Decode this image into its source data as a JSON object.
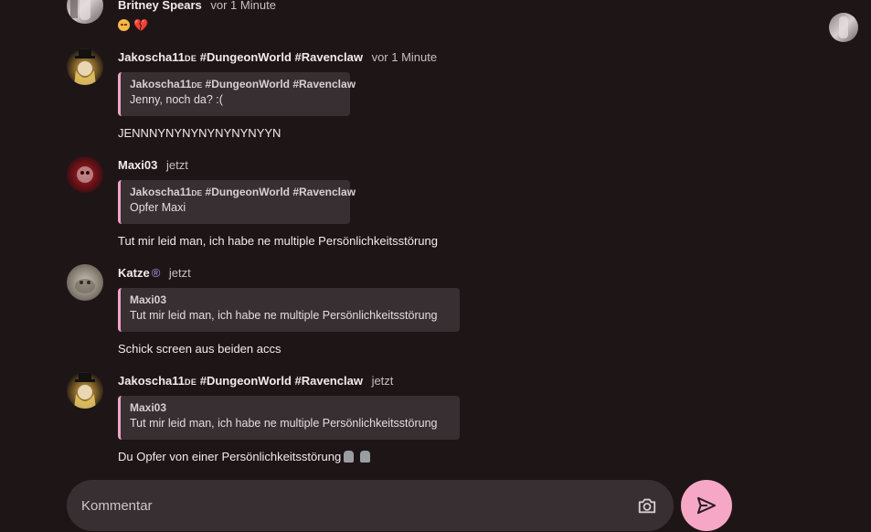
{
  "messages": [
    {
      "author": "Britney Spears",
      "author_suffix": "",
      "tags": "",
      "time": "vor 1 Minute",
      "quote": null,
      "body": ""
    },
    {
      "author": "Jakoscha11",
      "author_suffix": "DE",
      "tags": "#DungeonWorld #Ravenclaw",
      "time": "vor 1 Minute",
      "quote": {
        "author": "Jakoscha11",
        "author_suffix": "DE",
        "tags": "#DungeonWorld #Ravenclaw",
        "text": "Jenny, noch da? :("
      },
      "body": "JENNNYNYNYNYNYNYNYYN"
    },
    {
      "author": "Maxi03",
      "author_suffix": "",
      "tags": "",
      "time": "jetzt",
      "quote": {
        "author": "Jakoscha11",
        "author_suffix": "DE",
        "tags": "#DungeonWorld #Ravenclaw",
        "text": "Opfer Maxi"
      },
      "body": "Tut mir leid man, ich habe ne multiple Persönlichkeitsstörung"
    },
    {
      "author": "Katze",
      "author_suffix": "",
      "tags": "",
      "verified": "®",
      "time": "jetzt",
      "quote": {
        "author": "Maxi03",
        "author_suffix": "",
        "tags": "",
        "text": "Tut mir leid man, ich habe ne multiple Persönlichkeitsstörung"
      },
      "body": "Schick screen aus beiden accs"
    },
    {
      "author": "Jakoscha11",
      "author_suffix": "DE",
      "tags": "#DungeonWorld #Ravenclaw",
      "time": "jetzt",
      "quote": {
        "author": "Maxi03",
        "author_suffix": "",
        "tags": "",
        "text": "Tut mir leid man, ich habe ne multiple Persönlichkeitsstörung"
      },
      "body": "Du Opfer von einer Persönlichkeitsstörung"
    }
  ],
  "composer": {
    "placeholder": "Kommentar"
  },
  "colors": {
    "background": "#1e1517",
    "accent": "#f7a7c6",
    "quote_bg": "#372f32",
    "quote_bar": "#f2a4c4"
  },
  "icons": {
    "camera": "camera-icon",
    "send": "send-icon",
    "heart": "broken-heart-icon",
    "face": "sad-face-icon",
    "moai": "moai-icon"
  }
}
